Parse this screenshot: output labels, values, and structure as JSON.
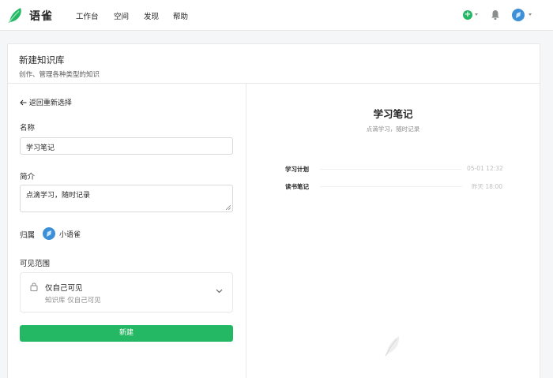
{
  "header": {
    "brand": "语雀",
    "nav": [
      "工作台",
      "空间",
      "发现",
      "帮助"
    ],
    "add_label": "+"
  },
  "page": {
    "title": "新建知识库",
    "subtitle": "创作、管理各种类型的知识"
  },
  "form": {
    "back_label": "返回重新选择",
    "name_label": "名称",
    "name_value": "学习笔记",
    "intro_label": "简介",
    "intro_value": "点滴学习，随时记录",
    "owner_label": "归属",
    "owner_name": "小语雀",
    "visibility_label": "可见范围",
    "visibility_title": "仅自己可见",
    "visibility_desc": "知识库 仅自己可见",
    "create_label": "新建"
  },
  "preview": {
    "title": "学习笔记",
    "desc": "点滴学习，随时记录",
    "docs": [
      {
        "name": "学习计划",
        "time": "05-01 12:32"
      },
      {
        "name": "读书笔记",
        "time": "昨天 18:00"
      }
    ]
  },
  "colors": {
    "accent": "#25b864",
    "avatar": "#3d8fd8"
  },
  "icons": [
    "logo-bird-icon",
    "plus-circle-icon",
    "bell-icon",
    "user-avatar-icon",
    "arrow-left-icon",
    "lock-icon",
    "chevron-down-icon",
    "feather-icon"
  ]
}
